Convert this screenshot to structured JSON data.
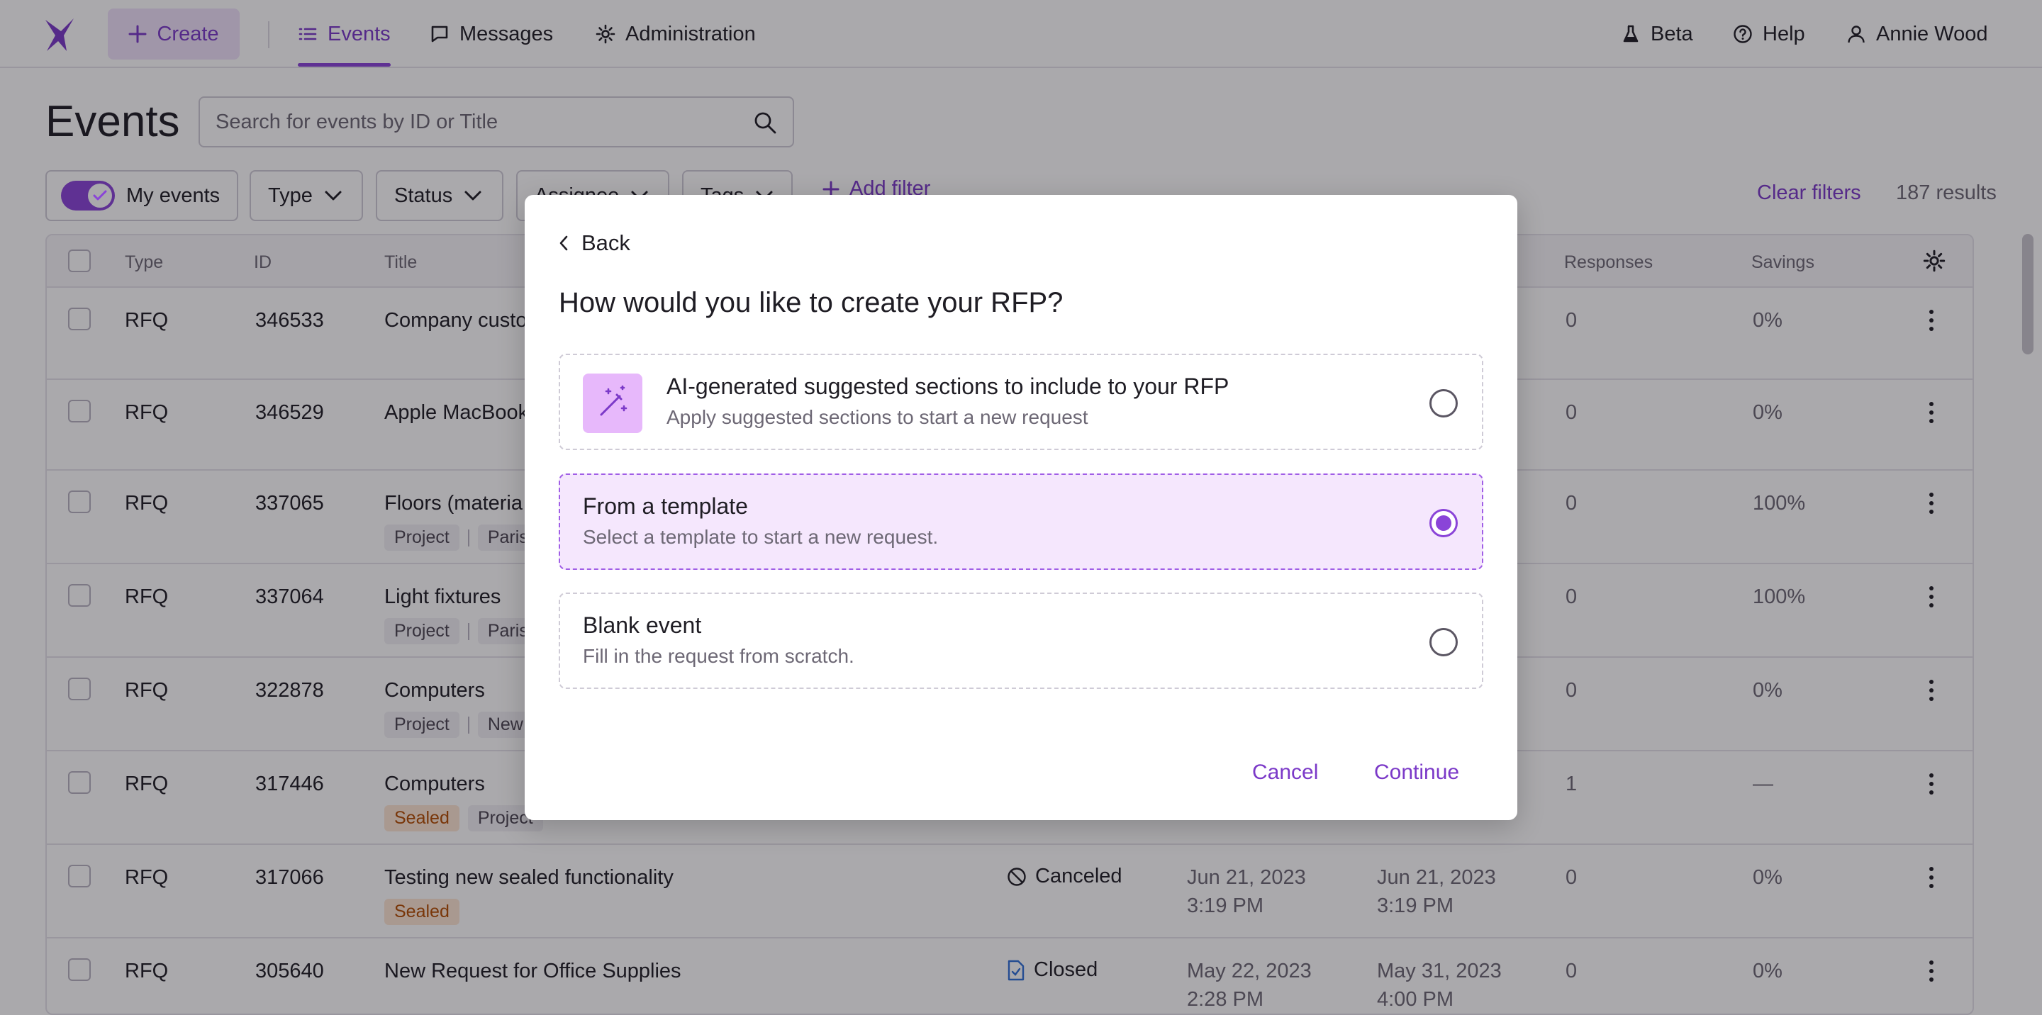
{
  "nav": {
    "create_label": "Create",
    "items": [
      {
        "label": "Events",
        "icon": "list-icon"
      },
      {
        "label": "Messages",
        "icon": "message-icon"
      },
      {
        "label": "Administration",
        "icon": "gear-icon"
      }
    ],
    "right": [
      {
        "label": "Beta",
        "icon": "flask-icon"
      },
      {
        "label": "Help",
        "icon": "help-icon"
      },
      {
        "label": "Annie Wood",
        "icon": "user-icon"
      }
    ]
  },
  "page": {
    "title": "Events",
    "search_placeholder": "Search for events by ID or Title"
  },
  "filters": {
    "my_events": "My events",
    "type": "Type",
    "status": "Status",
    "assignee": "Assignee",
    "tags": "Tags",
    "add_filter": "Add filter",
    "clear_filters": "Clear filters",
    "results": "187 results"
  },
  "table": {
    "headers": {
      "type": "Type",
      "id": "ID",
      "title": "Title",
      "responses": "Responses",
      "savings": "Savings"
    },
    "rows": [
      {
        "type": "RFQ",
        "id": "346533",
        "title": "Company custo",
        "tags": [],
        "status": "",
        "start": "",
        "end": "",
        "responses": "0",
        "savings": "0%"
      },
      {
        "type": "RFQ",
        "id": "346529",
        "title": "Apple MacBook",
        "tags": [],
        "status": "",
        "start": "",
        "end": "",
        "responses": "0",
        "savings": "0%"
      },
      {
        "type": "RFQ",
        "id": "337065",
        "title": "Floors (materia",
        "tags": [
          "Project",
          "Paris"
        ],
        "status": "",
        "start": "",
        "end": "",
        "responses": "0",
        "savings": "100%"
      },
      {
        "type": "RFQ",
        "id": "337064",
        "title": "Light fixtures",
        "tags": [
          "Project",
          "Paris"
        ],
        "status": "",
        "start": "",
        "end": "",
        "responses": "0",
        "savings": "100%"
      },
      {
        "type": "RFQ",
        "id": "322878",
        "title": "Computers",
        "tags": [
          "Project",
          "New T"
        ],
        "status": "",
        "start": "",
        "end": "",
        "responses": "0",
        "savings": "0%"
      },
      {
        "type": "RFQ",
        "id": "317446",
        "title": "Computers",
        "tags": [
          "Sealed",
          "Project"
        ],
        "status": "",
        "start": "",
        "end": "",
        "responses": "1",
        "savings": "—"
      },
      {
        "type": "RFQ",
        "id": "317066",
        "title": "Testing new sealed functionality",
        "tags": [
          "Sealed"
        ],
        "status": "Canceled",
        "start_date": "Jun 21, 2023",
        "start_time": "3:19 PM",
        "end_date": "Jun 21, 2023",
        "end_time": "3:19 PM",
        "responses": "0",
        "savings": "0%"
      },
      {
        "type": "RFQ",
        "id": "305640",
        "title": "New Request for Office Supplies",
        "tags": [],
        "status": "Closed",
        "start_date": "May 22, 2023",
        "start_time": "2:28 PM",
        "end_date": "May 31, 2023",
        "end_time": "4:00 PM",
        "responses": "0",
        "savings": "0%"
      }
    ]
  },
  "modal": {
    "back_label": "Back",
    "title": "How would you like to create your RFP?",
    "options": [
      {
        "title": "AI-generated suggested sections to include to your RFP",
        "description": "Apply suggested sections to start a new request",
        "selected": false,
        "icon": "magic-wand-icon"
      },
      {
        "title": "From a template",
        "description": "Select a template to start a new request.",
        "selected": true
      },
      {
        "title": "Blank event",
        "description": "Fill in the request from scratch.",
        "selected": false
      }
    ],
    "cancel_label": "Cancel",
    "continue_label": "Continue"
  },
  "colors": {
    "accent": "#8a44d8",
    "accent_text": "#7b39c8",
    "selected_bg": "#f5e7fd",
    "ai_icon_bg": "#e7b8fb",
    "sealed_tag": "#fde7d4"
  }
}
